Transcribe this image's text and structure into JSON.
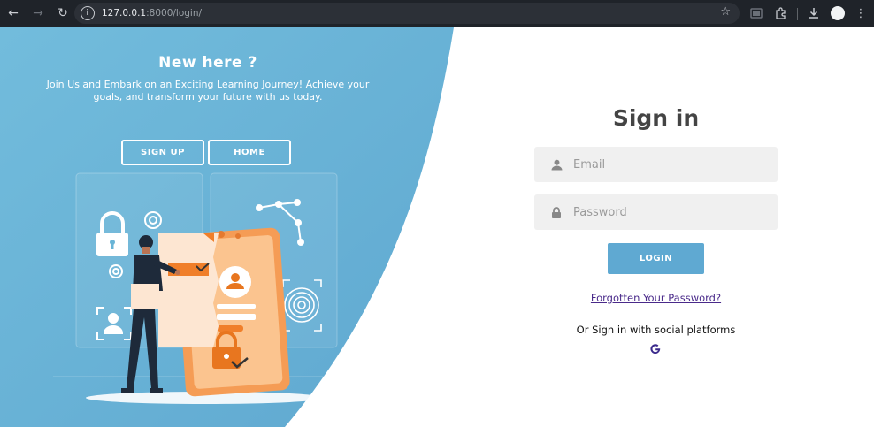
{
  "browser": {
    "url_host": "127.0.0.1",
    "url_rest": ":8000/login/",
    "icons": [
      "back-icon",
      "forward-icon",
      "reload-icon",
      "site-info-icon",
      "bookmark-star-icon",
      "extensions-icon",
      "download-icon",
      "profile-avatar",
      "menu-icon"
    ]
  },
  "panel": {
    "title": "New here ?",
    "text": "Join Us and Embark on an Exciting Learning Journey! Achieve your goals, and transform your future with us today.",
    "signup_label": "SIGN UP",
    "home_label": "HOME",
    "accent": "#69b4d6"
  },
  "form": {
    "title": "Sign in",
    "email_placeholder": "Email",
    "password_placeholder": "Password",
    "login_label": "LOGIN",
    "forgot_label": "Forgotten Your Password?",
    "social_text": "Or Sign in with social platforms",
    "social_icons": [
      "google-icon"
    ],
    "button_color": "#5fa9d2"
  }
}
